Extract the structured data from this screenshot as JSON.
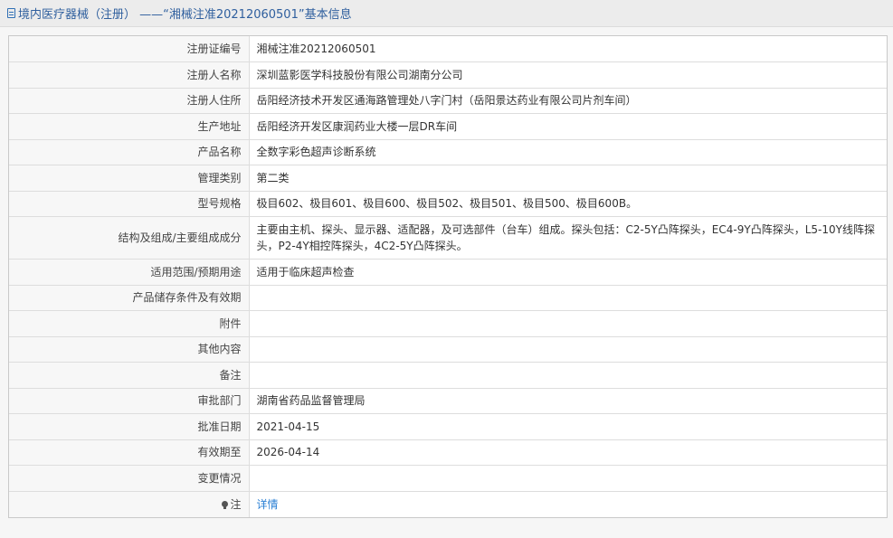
{
  "header": {
    "title": "境内医疗器械（注册） ——“湘械注准20212060501”基本信息"
  },
  "rows": [
    {
      "label": "注册证编号",
      "value": "湘械注准20212060501"
    },
    {
      "label": "注册人名称",
      "value": "深圳蓝影医学科技股份有限公司湖南分公司"
    },
    {
      "label": "注册人住所",
      "value": "岳阳经济技术开发区通海路管理处八字门村（岳阳景达药业有限公司片剂车间）"
    },
    {
      "label": "生产地址",
      "value": "岳阳经济开发区康润药业大楼一层DR车间"
    },
    {
      "label": "产品名称",
      "value": "全数字彩色超声诊断系统"
    },
    {
      "label": "管理类别",
      "value": "第二类"
    },
    {
      "label": "型号规格",
      "value": "极目602、极目601、极目600、极目502、极目501、极目500、极目600B。"
    },
    {
      "label": "结构及组成/主要组成成分",
      "value": "主要由主机、探头、显示器、适配器，及可选部件（台车）组成。探头包括：C2-5Y凸阵探头，EC4-9Y凸阵探头，L5-10Y线阵探头，P2-4Y相控阵探头，4C2-5Y凸阵探头。"
    },
    {
      "label": "适用范围/预期用途",
      "value": "适用于临床超声检查"
    },
    {
      "label": "产品储存条件及有效期",
      "value": ""
    },
    {
      "label": "附件",
      "value": ""
    },
    {
      "label": "其他内容",
      "value": ""
    },
    {
      "label": "备注",
      "value": ""
    },
    {
      "label": "审批部门",
      "value": "湖南省药品监督管理局"
    },
    {
      "label": "批准日期",
      "value": "2021-04-15"
    },
    {
      "label": "有效期至",
      "value": "2026-04-14"
    },
    {
      "label": "变更情况",
      "value": ""
    },
    {
      "label": "注",
      "value": "详情"
    }
  ],
  "icons": {
    "header_icon": "document-icon",
    "note_icon": "lightbulb-icon"
  },
  "colors": {
    "header_title": "#2f5f9e",
    "link": "#2a7fd4"
  }
}
